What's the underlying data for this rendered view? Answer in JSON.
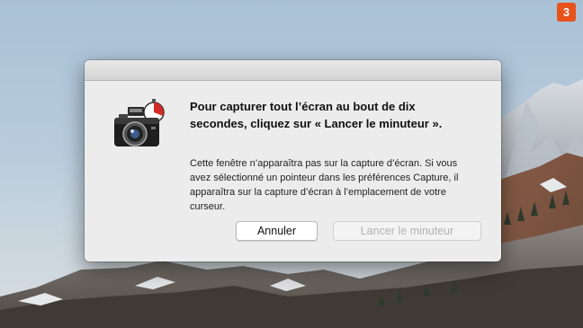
{
  "step_badge": "3",
  "dialog": {
    "heading": "Pour capturer tout l’écran au bout de dix secondes, cliquez sur « Lancer le minuteur ».",
    "body": "Cette fenêtre n’apparaîtra pas sur la capture d’écran. Si vous avez sélectionné un pointeur dans les préférences Capture, il apparaîtra sur la capture d’écran à l’emplacement de votre curseur.",
    "cancel_label": "Annuler",
    "start_timer_label": "Lancer le minuteur",
    "start_timer_enabled": false,
    "icon": "camera-timer-icon"
  },
  "colors": {
    "badge": "#e8521b",
    "dialog_bg": "#ececec"
  }
}
